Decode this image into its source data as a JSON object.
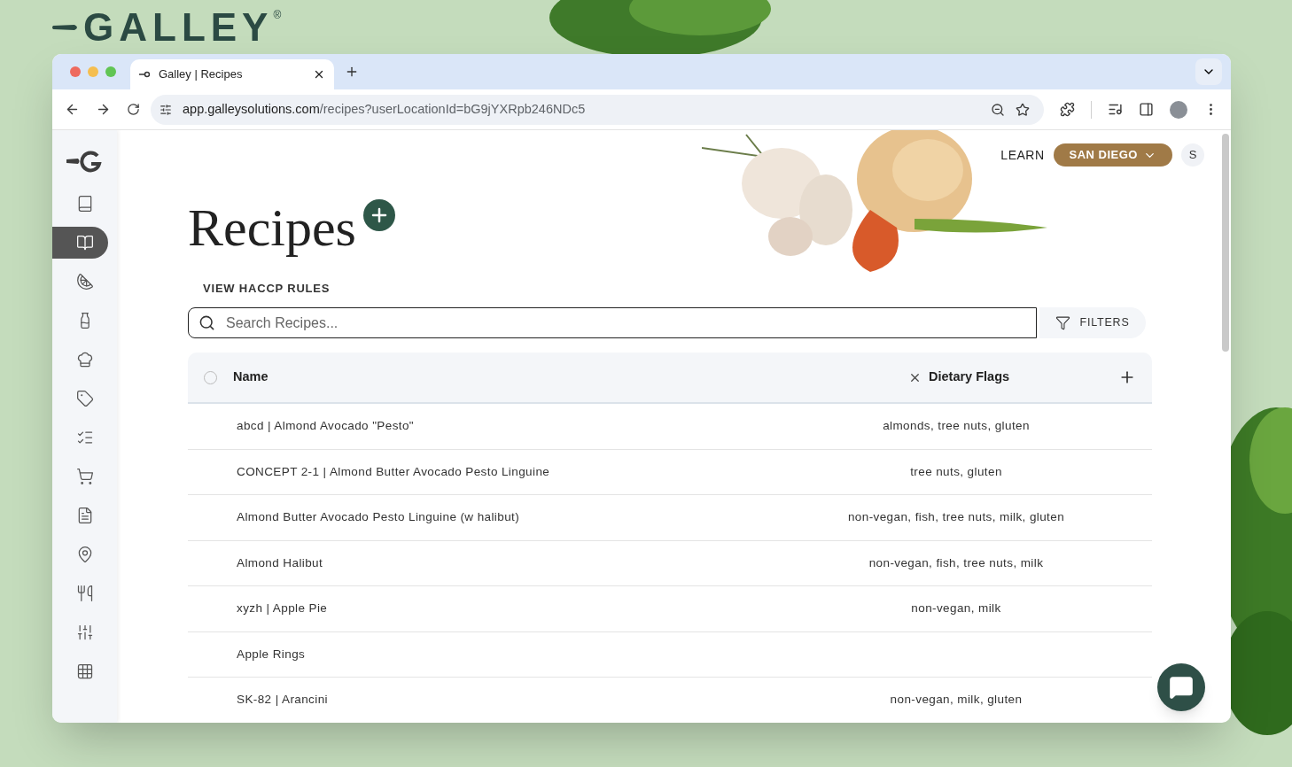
{
  "brand": {
    "name": "GALLEY",
    "mark": "®"
  },
  "browser": {
    "tab_title": "Galley | Recipes",
    "url_host": "app.galleysolutions.com",
    "url_path": "/recipes?userLocationId=bG9jYXRpb246NDc5"
  },
  "sidebar": {
    "items": [
      {
        "selected": false
      },
      {
        "selected": true
      },
      {
        "selected": false
      },
      {
        "selected": false
      },
      {
        "selected": false
      },
      {
        "selected": false
      },
      {
        "selected": false
      },
      {
        "selected": false
      },
      {
        "selected": false
      },
      {
        "selected": false
      },
      {
        "selected": false
      },
      {
        "selected": false
      },
      {
        "selected": false
      }
    ]
  },
  "header": {
    "learn": "LEARN",
    "location": "SAN DIEGO",
    "user_initial": "S"
  },
  "page": {
    "title": "Recipes",
    "link": "VIEW HACCP RULES"
  },
  "search": {
    "placeholder": "Search Recipes..."
  },
  "filters": "FILTERS",
  "table": {
    "select_all_checked": false,
    "columns": [
      "Name",
      "Dietary Flags"
    ],
    "rows": [
      {
        "name": "abcd | Almond Avocado \"Pesto\"",
        "flags": "almonds, tree nuts, gluten"
      },
      {
        "name": "CONCEPT 2-1 | Almond Butter Avocado Pesto Linguine",
        "flags": "tree nuts, gluten"
      },
      {
        "name": "Almond Butter Avocado Pesto Linguine (w halibut)",
        "flags": "non-vegan, fish, tree nuts, milk, gluten"
      },
      {
        "name": "Almond Halibut",
        "flags": "non-vegan, fish, tree nuts, milk"
      },
      {
        "name": "xyzh | Apple Pie",
        "flags": "non-vegan, milk"
      },
      {
        "name": "Apple Rings"
      },
      {
        "name": "SK-82 | Arancini",
        "flags": "non-vegan, milk, gluten"
      }
    ]
  }
}
